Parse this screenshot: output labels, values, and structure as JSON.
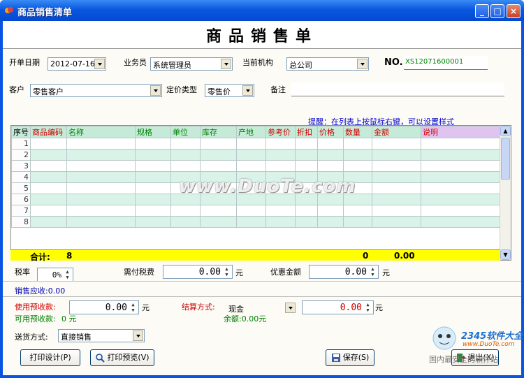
{
  "window": {
    "title": "商品销售清单"
  },
  "page_title": "商品销售单",
  "header": {
    "date_label": "开单日期",
    "date_value": "2012-07-16",
    "clerk_label": "业务员",
    "clerk_value": "系统管理员",
    "org_label": "当前机构",
    "org_value": "总公司",
    "no_label": "NO.",
    "no_value": "XS12071600001",
    "customer_label": "客户",
    "customer_value": "零售客户",
    "pricetype_label": "定价类型",
    "pricetype_value": "零售价",
    "remark_label": "备注",
    "remark_value": ""
  },
  "hint": "提醒：在列表上按鼠标右键，可以设置样式",
  "table": {
    "columns": [
      "序号",
      "商品编码",
      "名称",
      "规格",
      "单位",
      "库存",
      "产地",
      "参考价",
      "折扣",
      "价格",
      "数量",
      "金额",
      "说明"
    ],
    "rows": [
      "1",
      "2",
      "3",
      "4",
      "5",
      "6",
      "7",
      "8"
    ],
    "total_label": "合计:",
    "total_count": "8",
    "total_qty": "0",
    "total_amount": "0.00"
  },
  "tax": {
    "rate_label": "税率",
    "rate_value": "0%",
    "tax_due_label": "需付税费",
    "tax_due_value": "0.00",
    "unit": "元",
    "discount_label": "优惠金额",
    "discount_value": "0.00"
  },
  "receivable": "销售应收:0.00",
  "payment": {
    "prepaid_label": "使用预收款:",
    "prepaid_value": "0.00",
    "available_label": "可用预收款:",
    "available_value": "0 元",
    "settle_label": "结算方式:",
    "settle_value": "现金",
    "settle_amount": "0.00",
    "balance_label": "余额:0.00元",
    "unit": "元"
  },
  "delivery": {
    "label": "送货方式:",
    "value": "直接销售"
  },
  "buttons": {
    "print_design": "打印设计(P)",
    "print_preview": "打印预览(V)",
    "save": "保存(S)",
    "exit": "退出(X)"
  },
  "watermark": "www.DuoTe.com",
  "corner_logo": {
    "brand": "2345软件大全",
    "url": "www.DuoTe.com",
    "footer": "国内最安全的软件站"
  },
  "colors": {
    "title_bar": "#0a58e0",
    "grid_header": "#c5ebd8",
    "alt_row": "#d9f3e9",
    "total_row": "#ffff00",
    "red_text": "#d00000",
    "green_text": "#008000"
  }
}
